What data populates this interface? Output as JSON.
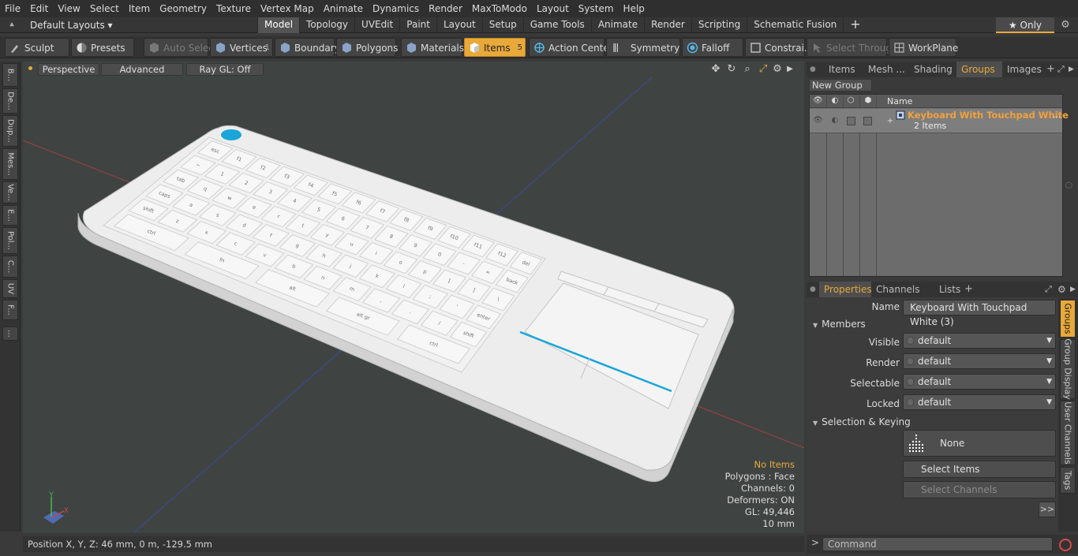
{
  "menubar": [
    "File",
    "Edit",
    "View",
    "Select",
    "Item",
    "Geometry",
    "Texture",
    "Vertex Map",
    "Animate",
    "Dynamics",
    "Render",
    "MaxToModo",
    "Layout",
    "System",
    "Help"
  ],
  "layoutbar": {
    "layouts_label": "Default Layouts ▾",
    "tabs": [
      "Model",
      "Topology",
      "UVEdit",
      "Paint",
      "Layout",
      "Setup",
      "Game Tools",
      "Animate",
      "Render",
      "Scripting",
      "Schematic Fusion"
    ],
    "active_tab": "Model",
    "plus": "+",
    "only_label": "★  Only",
    "gear": "⚙"
  },
  "toolbar": {
    "sculpt": "Sculpt",
    "presets": "Presets",
    "auto_select": "Auto Select",
    "vertices": "Vertices",
    "vertices_count": "1",
    "boundary": "Boundary",
    "polygons": "Polygons",
    "materials": "Materials",
    "items": "Items",
    "items_count": "5",
    "action_center": "Action Center",
    "symmetry": "Symmetry",
    "falloff": "Falloff",
    "constraints": "Constrai...",
    "select_through": "Select Through",
    "workplane": "WorkPlane"
  },
  "left_tabs": [
    "B...",
    "De...",
    "Dup...",
    "Mes...",
    "Ve...",
    "E...",
    "Pol...",
    "C...",
    "UV",
    "F...",
    "..."
  ],
  "viewport": {
    "perspective": "Perspective",
    "advanced": "Advanced",
    "raygl": "Ray GL: Off",
    "info": {
      "selection": "No Items",
      "polygons": "Polygons : Face",
      "channels": "Channels: 0",
      "deformers": "Deformers: ON",
      "gl": "GL: 49,446",
      "scale": "10 mm"
    },
    "axis_y": "Y",
    "axis_x": "X"
  },
  "status": "Position X, Y, Z:  46 mm, 0 m, -129.5 mm",
  "right_tabs": [
    "Items",
    "Mesh ...",
    "Shading",
    "Groups",
    "Images"
  ],
  "right_active_tab": "Groups",
  "groups": {
    "new_group": "New Group",
    "col_name": "Name",
    "row_title": "Keyboard With Touchpad White",
    "row_sub": "2 Items",
    "row_more": "..."
  },
  "prop_tabs": [
    "Properties",
    "Channels",
    "Lists"
  ],
  "prop_active_tab": "Properties",
  "properties": {
    "name_label": "Name",
    "name_value": "Keyboard With Touchpad White (3)",
    "members_section": "Members",
    "visible_label": "Visible",
    "render_label": "Render",
    "selectable_label": "Selectable",
    "locked_label": "Locked",
    "default_value": "default",
    "selection_section": "Selection & Keying",
    "none_label": "None",
    "select_items": "Select Items",
    "select_channels": "Select Channels",
    "more": ">>"
  },
  "right_vtabs": [
    "Groups",
    "Group Display",
    "User Channels",
    "Tags"
  ],
  "command": {
    "prompt": ">",
    "placeholder": "Command"
  },
  "keyboard_keys": {
    "row1": [
      "esc",
      "f1",
      "f2",
      "f3",
      "f4",
      "f5",
      "f6",
      "f7",
      "f8",
      "f9",
      "f10",
      "f11",
      "f12",
      "del"
    ],
    "row2": [
      "~",
      "1",
      "2",
      "3",
      "4",
      "5",
      "6",
      "7",
      "8",
      "9",
      "0",
      "-",
      "=",
      "back"
    ],
    "row3": [
      "tab",
      "q",
      "w",
      "e",
      "r",
      "t",
      "y",
      "u",
      "i",
      "o",
      "p",
      "[",
      "]",
      "\\"
    ],
    "row4": [
      "caps",
      "a",
      "s",
      "d",
      "f",
      "g",
      "h",
      "j",
      "k",
      "l",
      ";",
      "'",
      "enter"
    ],
    "row5": [
      "shift",
      "z",
      "x",
      "c",
      "v",
      "b",
      "n",
      "m",
      ",",
      ".",
      "/",
      "shift"
    ],
    "row6": [
      "ctrl",
      "fn",
      "alt",
      "alt gr",
      "ctrl"
    ]
  },
  "colors": {
    "accent": "#e8a93a",
    "group_title": "#f2a13b",
    "keyboard_logo": "#1aa6d8"
  }
}
